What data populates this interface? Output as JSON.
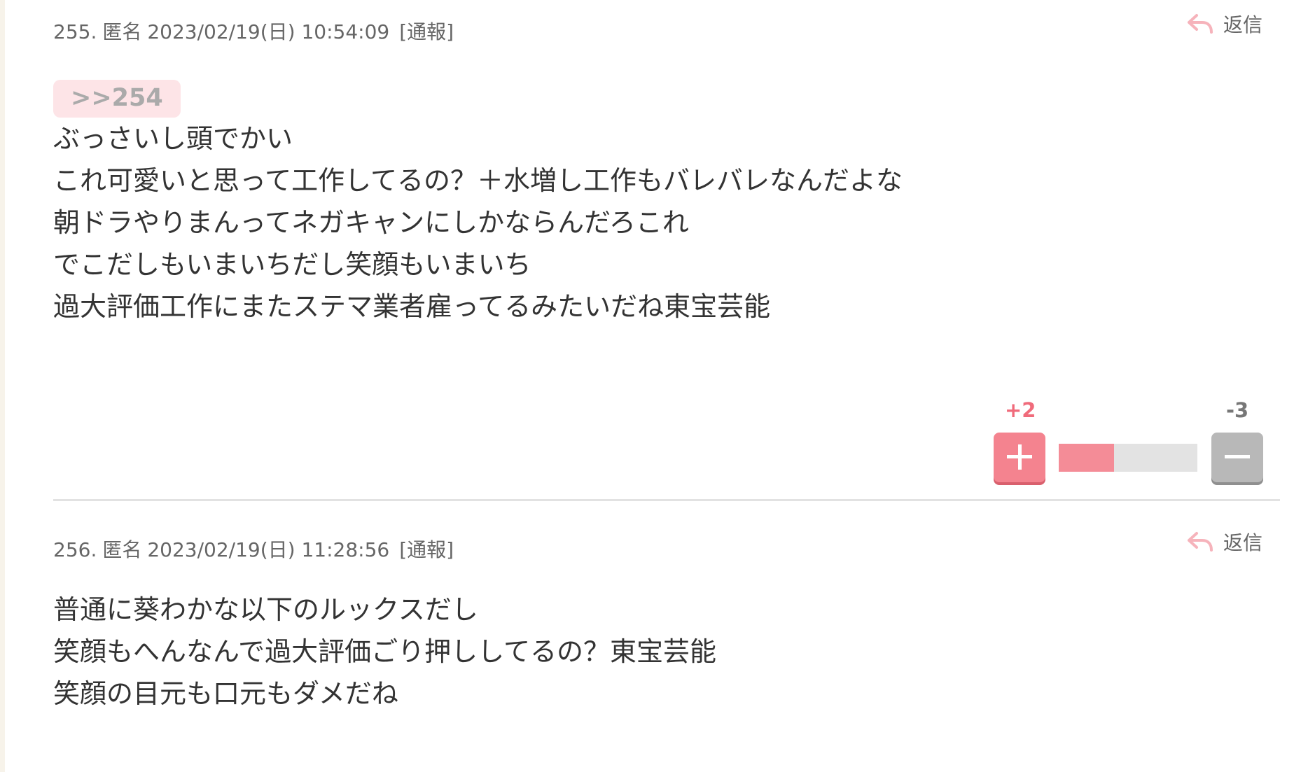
{
  "comments": [
    {
      "number": "255.",
      "author": "匿名",
      "datetime": "2023/02/19(日) 10:54:09",
      "report_label": "[通報]",
      "reply_label": "返信",
      "anchor": ">>254",
      "lines": [
        "ぶっさいし頭でかい",
        "これ可愛いと思って工作してるの？＋水増し工作もバレバレなんだよな",
        "朝ドラやりまんってネガキャンにしかならんだろこれ",
        "でこだしもいまいちだし笑顔もいまいち",
        "過大評価工作にまたステマ業者雇ってるみたいだね東宝芸能"
      ],
      "votes": {
        "plus_label": "+2",
        "minus_label": "-3",
        "plus": 2,
        "minus": 3,
        "plus_ratio": 0.4
      }
    },
    {
      "number": "256.",
      "author": "匿名",
      "datetime": "2023/02/19(日) 11:28:56",
      "report_label": "[通報]",
      "reply_label": "返信",
      "lines": [
        "普通に葵わかな以下のルックスだし",
        "笑顔もへんなんで過大評価ごり押ししてるの？東宝芸能",
        "笑顔の目元も口元もダメだね"
      ]
    }
  ],
  "colors": {
    "accent_pink": "#f4838f",
    "anchor_bg": "#fde4e7",
    "minus_gray": "#b8b8b8",
    "track_gray": "#e3e3e3"
  },
  "icons": {
    "reply": "reply-arrow-icon",
    "plus": "plus-icon",
    "minus": "minus-icon"
  }
}
